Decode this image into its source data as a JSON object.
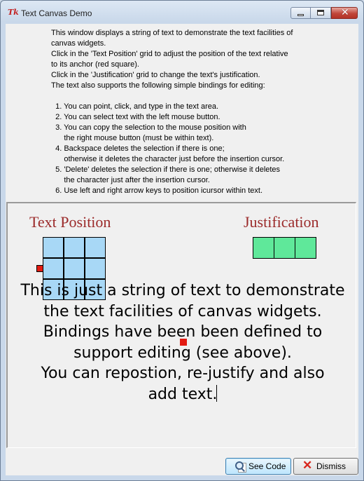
{
  "window": {
    "title": "Text Canvas Demo",
    "app_icon": "Tk"
  },
  "description": [
    "This window displays a string of text to demonstrate the text facilities of",
    "canvas widgets.",
    "Click in the 'Text Position' grid to adjust the position of the text relative",
    "to its anchor (red square).",
    "Click in the 'Justification' grid to change the text's justification.",
    "The text also supports the following simple bindings for editing:",
    "",
    "  1. You can point, click, and type in the text area.",
    "  2. You can select text with the left mouse button.",
    "  3. You can copy the selection to the mouse position with",
    "      the right mouse button (must be within text).",
    "  4. Backspace deletes the selection if there is one;",
    "      otherwise it deletes the character just before the insertion cursor.",
    "  5. 'Delete' deletes the selection if there is one; otherwise it deletes",
    "      the character just after the insertion cursor.",
    "  6. Use left and right arrow keys to position icursor within text."
  ],
  "canvas": {
    "position_title": "Text Position",
    "justification_title": "Justification",
    "demo_text": [
      "This is just a string of text to demonstrate",
      "the text facilities of canvas widgets.",
      "Bindings have been been defined to",
      "support editing (see above).",
      "You can repostion, re-justify and also",
      "add text."
    ],
    "colors": {
      "title": "#9b2a2a",
      "position_cell": "#a8d8f6",
      "justification_cell": "#5fe89a",
      "anchor": "#e31b12"
    }
  },
  "buttons": {
    "see_code": "See Code",
    "dismiss": "Dismiss"
  },
  "icons": {
    "see_code": "magnifier-icon",
    "dismiss": "red-x-icon"
  }
}
